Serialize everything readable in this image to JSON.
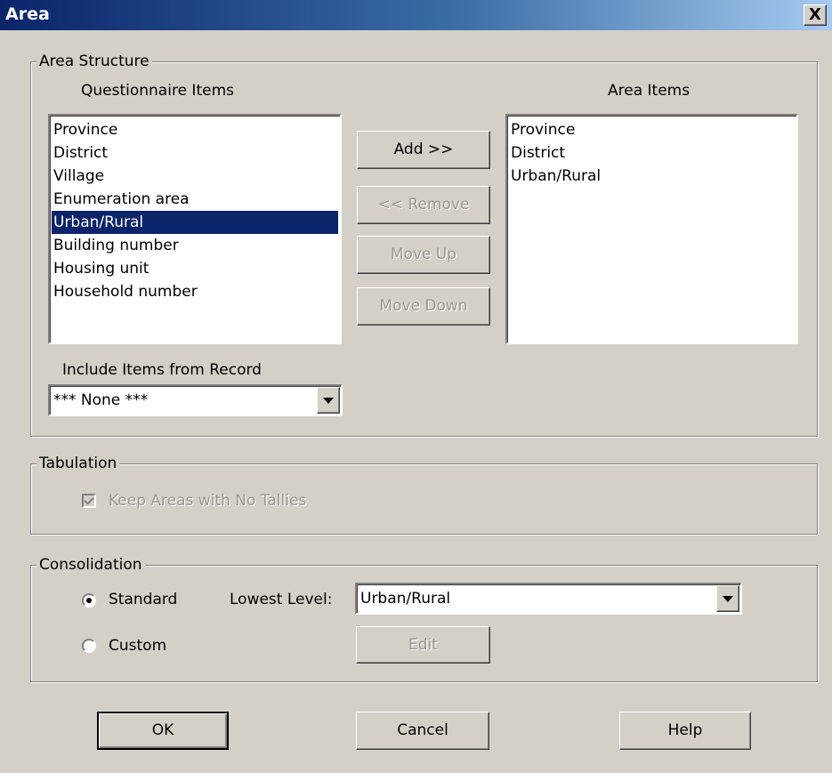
{
  "window": {
    "title": "Area",
    "close_label": "X"
  },
  "area_structure": {
    "group_label": "Area Structure",
    "questionnaire_label": "Questionnaire Items",
    "area_items_label": "Area Items",
    "questionnaire_items": [
      "Province",
      "District",
      "Village",
      "Enumeration area",
      "Urban/Rural",
      "Building number",
      "Housing unit",
      "Household number"
    ],
    "selected_questionnaire_item": "Urban/Rural",
    "area_items": [
      "Province",
      "District",
      "Urban/Rural"
    ],
    "buttons": {
      "add": "Add >>",
      "remove": "<< Remove",
      "move_up": "Move Up",
      "move_down": "Move Down"
    },
    "include_label": "Include Items from Record",
    "include_value": "*** None ***"
  },
  "tabulation": {
    "group_label": "Tabulation",
    "keep_areas_label": "Keep Areas with No Tallies",
    "keep_areas_checked": true
  },
  "consolidation": {
    "group_label": "Consolidation",
    "standard_label": "Standard",
    "custom_label": "Custom",
    "selected": "Standard",
    "lowest_level_label": "Lowest Level:",
    "lowest_level_value": "Urban/Rural",
    "edit_label": "Edit"
  },
  "footer": {
    "ok": "OK",
    "cancel": "Cancel",
    "help": "Help"
  }
}
